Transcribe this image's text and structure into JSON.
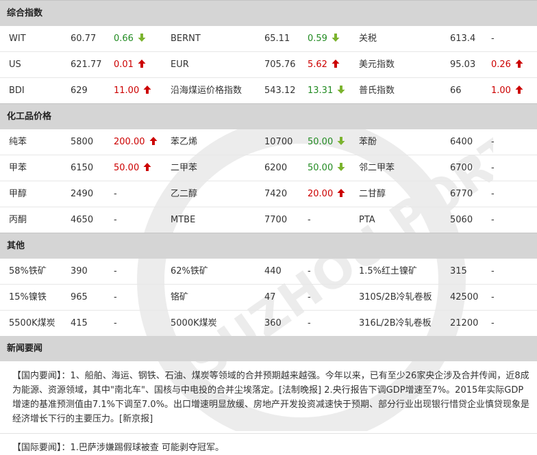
{
  "sections": {
    "composite": {
      "title": "综合指数",
      "rows": [
        [
          {
            "name": "WIT",
            "value": "60.77",
            "change": "0.66",
            "dir": "down"
          },
          {
            "name": "BERNT",
            "value": "65.11",
            "change": "0.59",
            "dir": "down"
          },
          {
            "name": "关税",
            "value": "613.4",
            "change": "-",
            "dir": "none"
          }
        ],
        [
          {
            "name": "US",
            "value": "621.77",
            "change": "0.01",
            "dir": "up"
          },
          {
            "name": "EUR",
            "value": "705.76",
            "change": "5.62",
            "dir": "up"
          },
          {
            "name": "美元指数",
            "value": "95.03",
            "change": "0.26",
            "dir": "up"
          }
        ],
        [
          {
            "name": "BDI",
            "value": "629",
            "change": "11.00",
            "dir": "up"
          },
          {
            "name": "沿海煤运价格指数",
            "value": "543.12",
            "change": "13.31",
            "dir": "down"
          },
          {
            "name": "普氏指数",
            "value": "66",
            "change": "1.00",
            "dir": "up"
          }
        ]
      ]
    },
    "chemical": {
      "title": "化工品价格",
      "rows": [
        [
          {
            "name": "纯苯",
            "value": "5800",
            "change": "200.00",
            "dir": "up"
          },
          {
            "name": "苯乙烯",
            "value": "10700",
            "change": "50.00",
            "dir": "down"
          },
          {
            "name": "苯酚",
            "value": "6400",
            "change": "-",
            "dir": "none"
          }
        ],
        [
          {
            "name": "甲苯",
            "value": "6150",
            "change": "50.00",
            "dir": "up"
          },
          {
            "name": "二甲苯",
            "value": "6200",
            "change": "50.00",
            "dir": "down"
          },
          {
            "name": "邻二甲苯",
            "value": "6700",
            "change": "-",
            "dir": "none"
          }
        ],
        [
          {
            "name": "甲醇",
            "value": "2490",
            "change": "-",
            "dir": "none"
          },
          {
            "name": "乙二醇",
            "value": "7420",
            "change": "20.00",
            "dir": "up"
          },
          {
            "name": "二甘醇",
            "value": "6770",
            "change": "-",
            "dir": "none"
          }
        ],
        [
          {
            "name": "丙酮",
            "value": "4650",
            "change": "-",
            "dir": "none"
          },
          {
            "name": "MTBE",
            "value": "7700",
            "change": "-",
            "dir": "none"
          },
          {
            "name": "PTA",
            "value": "5060",
            "change": "-",
            "dir": "none"
          }
        ]
      ]
    },
    "other": {
      "title": "其他",
      "rows": [
        [
          {
            "name": "58%铁矿",
            "value": "390",
            "change": "-",
            "dir": "none"
          },
          {
            "name": "62%铁矿",
            "value": "440",
            "change": "-",
            "dir": "none"
          },
          {
            "name": "1.5%红土镍矿",
            "value": "315",
            "change": "-",
            "dir": "none"
          }
        ],
        [
          {
            "name": "15%镍铁",
            "value": "965",
            "change": "-",
            "dir": "none"
          },
          {
            "name": "铬矿",
            "value": "47",
            "change": "-",
            "dir": "none"
          },
          {
            "name": "310S/2B冷轧卷板",
            "value": "42500",
            "change": "-",
            "dir": "none"
          }
        ],
        [
          {
            "name": "5500K煤炭",
            "value": "415",
            "change": "-",
            "dir": "none"
          },
          {
            "name": "5000K煤炭",
            "value": "360",
            "change": "-",
            "dir": "none"
          },
          {
            "name": "316L/2B冷轧卷板",
            "value": "21200",
            "change": "-",
            "dir": "none"
          }
        ]
      ]
    }
  },
  "news": {
    "title": "新闻要闻",
    "domestic": "【国内要闻】：1、船舶、海运、钢铁、石油、煤炭等领域的合并预期越来越强。今年以来，已有至少26家央企涉及合并传闻，近8成为能源、资源领域，其中\"南北车\"、国核与中电投的合并尘埃落定。[法制晚报] 2.央行报告下调GDP增速至7%。2015年实际GDP增速的基准预测值由7.1%下调至7.0%。出口增速明显放缓、房地产开发投资减速快于预期、部分行业出现银行惜贷企业慎贷现象是经济增长下行的主要压力。[新京报]",
    "international": "【国际要闻】：1.巴萨涉嫌踢假球被查 可能剥夺冠军。"
  },
  "watermark_text": "SUZHOU PORT",
  "colors": {
    "up": "#cc0000",
    "down": "#228b22",
    "header_bg": "#d5d5d5"
  },
  "icons": {
    "up": "red-up-arrow-icon",
    "down": "green-down-arrow-icon"
  }
}
